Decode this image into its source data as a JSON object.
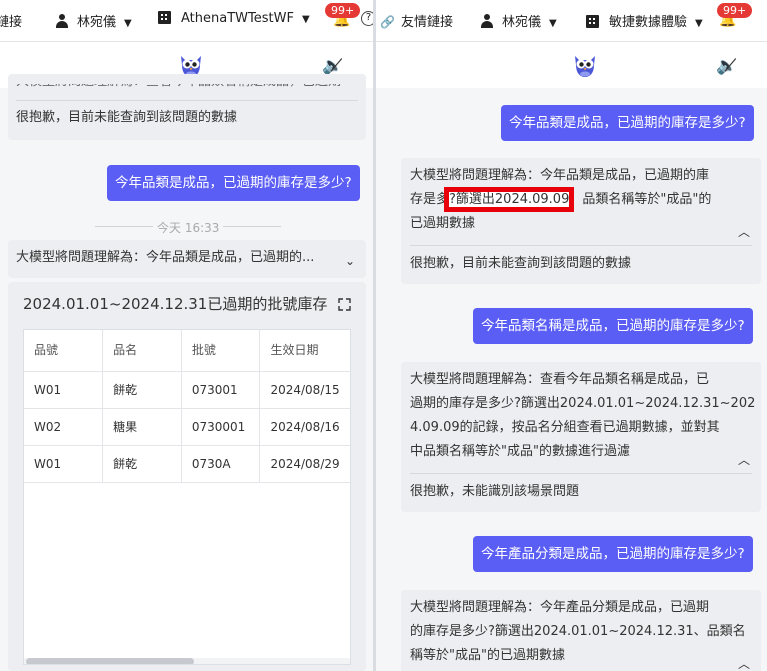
{
  "left": {
    "topbar": {
      "link_text": "鏈接",
      "user_name": "林宛儀",
      "tenant": "AthenaTWTestWF",
      "badge": "99+"
    },
    "card1": {
      "truncated_top": "大模型將問題理解為：查看今年品類名稱是成品，已過期",
      "answer": "很抱歉，目前未能查詢到該問題的數據"
    },
    "question": "今年品類是成品，已過期的庫存是多少?",
    "time_label": "今天 16:33",
    "card2": {
      "summary": "大模型將問題理解為：今年品類是成品，已過期的..."
    },
    "table_card": {
      "title": "2024.01.01~2024.12.31已過期的批號庫存",
      "columns": [
        "品號",
        "品名",
        "批號",
        "生效日期"
      ],
      "rows": [
        [
          "W01",
          "餅乾",
          "073001",
          "2024/08/15"
        ],
        [
          "W02",
          "糖果",
          "0730001",
          "2024/08/16"
        ],
        [
          "W01",
          "餅乾",
          "0730A",
          "2024/08/29"
        ]
      ]
    }
  },
  "right": {
    "topbar": {
      "link_text": "友情鏈接",
      "user_name": "林宛儀",
      "tenant": "敏捷數據體驗",
      "badge": "99+"
    },
    "q1": "今年品類是成品，已過期的庫存是多少?",
    "a1": {
      "line1": "大模型將問題理解為：今年品類是成品，已過期的庫",
      "line2_pre": "存是多",
      "line2_highlight": "?篩選出2024.09.09",
      "line2_post": "、品類名稱等於\"成品\"的",
      "line3": "已過期數據",
      "answer": "很抱歉，目前未能查詢到該問題的數據"
    },
    "q2": "今年品類名稱是成品，已過期的庫存是多少?",
    "a2": {
      "line1": "大模型將問題理解為：查看今年品類名稱是成品，已",
      "line2": "過期的庫存是多少?篩選出2024.01.01~2024.12.31~202",
      "line3": "4.09.09的記錄，按品名分組查看已過期數據，並對其",
      "line4": "中品類名稱等於\"成品\"的數據進行過濾",
      "answer": "很抱歉，未能識別該場景問題"
    },
    "q3": "今年產品分類是成品，已過期的庫存是多少?",
    "a3": {
      "line1": "大模型將問題理解為：今年產品分類是成品，已過期",
      "line2": "的庫存是多少?篩選出2024.01.01~2024.12.31、品類名",
      "line3": "稱等於\"成品\"的已過期數據"
    }
  },
  "colors": {
    "accent": "#5b5ef4",
    "highlight_border": "#e8000b",
    "badge": "#e53935"
  }
}
